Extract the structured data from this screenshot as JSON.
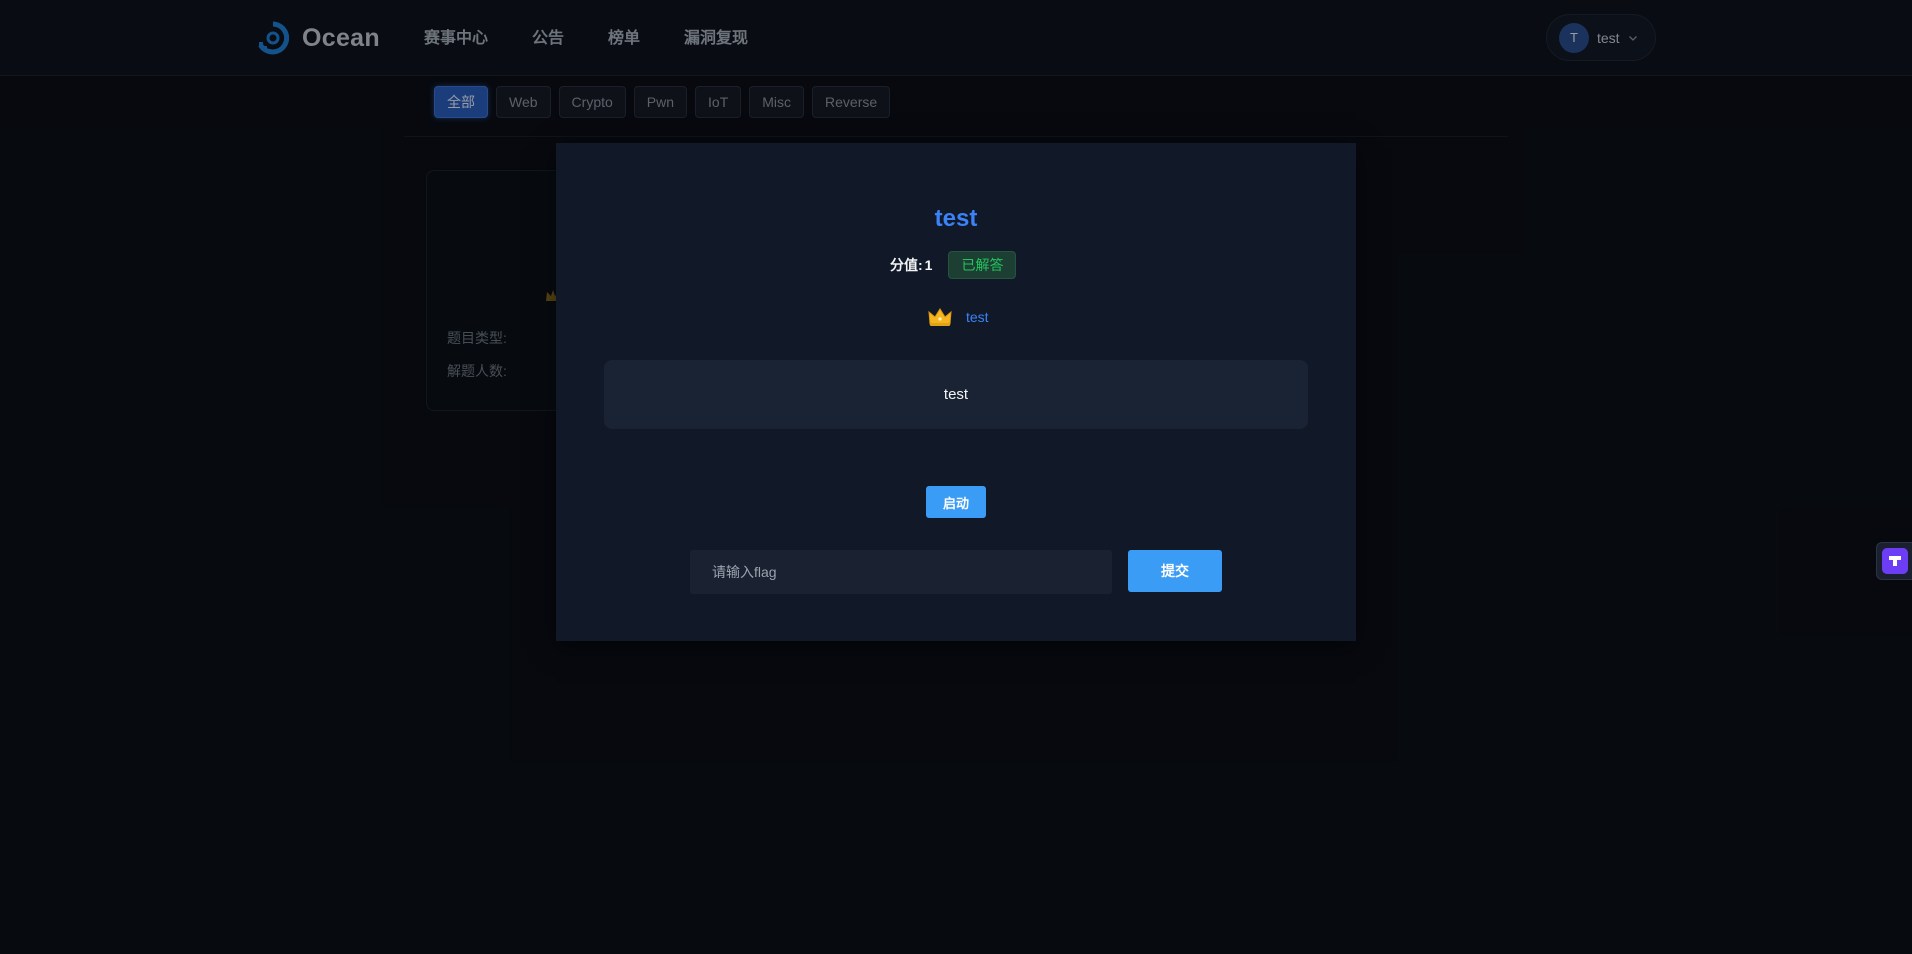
{
  "brand": {
    "name": "Ocean"
  },
  "nav": {
    "items": [
      "赛事中心",
      "公告",
      "榜单",
      "漏洞复现"
    ]
  },
  "user": {
    "initial": "T",
    "name": "test"
  },
  "filters": {
    "items": [
      "全部",
      "Web",
      "Crypto",
      "Pwn",
      "IoT",
      "Misc",
      "Reverse"
    ],
    "selected": "全部"
  },
  "background_card": {
    "type_label": "题目类型:",
    "solvers_label": "解题人数:"
  },
  "modal": {
    "title": "test",
    "score_label": "分值:",
    "score_value": "1",
    "status_badge": "已解答",
    "first_blood_user": "test",
    "description": "test",
    "launch_label": "启动",
    "flag_placeholder": "请输入flag",
    "submit_label": "提交"
  },
  "colors": {
    "accent_blue": "#3b82f6",
    "button_blue": "#3b9cf5",
    "success_green": "#22c55e",
    "background": "#0b0f17",
    "modal_bg": "#111827"
  },
  "icons": {
    "logo": "ocean-logo-icon",
    "chevron": "chevron-down-icon",
    "crown": "crown-icon",
    "side_widget": "plugin-widget-icon"
  }
}
